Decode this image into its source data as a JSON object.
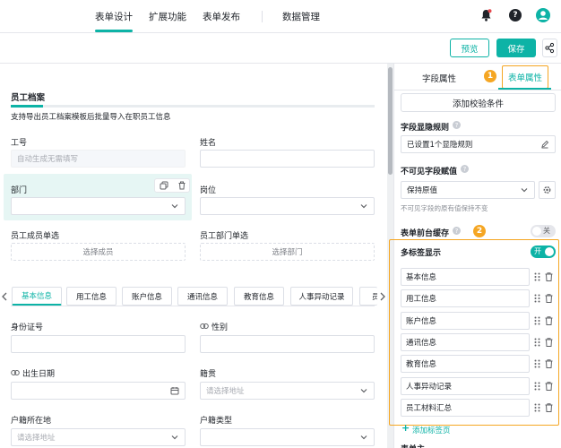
{
  "nav": {
    "tabs": [
      "表单设计",
      "扩展功能",
      "表单发布",
      "数据管理"
    ],
    "active": "表单设计"
  },
  "toolbar": {
    "preview_label": "预览",
    "save_label": "保存"
  },
  "form": {
    "title": "员工档案",
    "subtitle": "支持导出员工档案模板后批量导入在职员工信息",
    "fields": {
      "emp_no": {
        "label": "工号",
        "placeholder": "自动生成无需填写"
      },
      "name": {
        "label": "姓名"
      },
      "dept": {
        "label": "部门"
      },
      "post": {
        "label": "岗位"
      },
      "member_single": {
        "label": "员工成员单选",
        "button": "选择成员"
      },
      "dept_single": {
        "label": "员工部门单选",
        "button": "选择部门"
      },
      "id_no": {
        "label": "身份证号"
      },
      "gender": {
        "label": "性别"
      },
      "birth": {
        "label": "出生日期"
      },
      "native": {
        "label": "籍贯",
        "placeholder": "请选择地址"
      },
      "hukou_loc": {
        "label": "户籍所在地",
        "placeholder": "请选择地址"
      },
      "hukou_type": {
        "label": "户籍类型"
      }
    },
    "tabs": [
      "基本信息",
      "用工信息",
      "账户信息",
      "通讯信息",
      "教育信息",
      "人事异动记录",
      "员"
    ]
  },
  "panel": {
    "tabs": [
      "字段属性",
      "表单属性"
    ],
    "badge1": "1",
    "badge2": "2",
    "add_validation": "添加校验条件",
    "visibility": {
      "label": "字段显隐规则",
      "value": "已设置1个显隐规则"
    },
    "invisible": {
      "label": "不可见字段赋值",
      "value": "保持原值",
      "hint": "不可见字段的原有值保持不变"
    },
    "cache": {
      "label": "表单前台缓存",
      "toggle": "关"
    },
    "multitab": {
      "label": "多标签显示",
      "toggle": "开",
      "items": [
        "基本信息",
        "用工信息",
        "账户信息",
        "通讯信息",
        "教育信息",
        "人事异动记录",
        "员工材料汇总"
      ],
      "add_label": "添加标签页"
    },
    "clipped_label": "表单主"
  },
  "colors": {
    "accent": "#0db3a6",
    "highlight": "#f5a623",
    "danger": "#e5484d"
  }
}
